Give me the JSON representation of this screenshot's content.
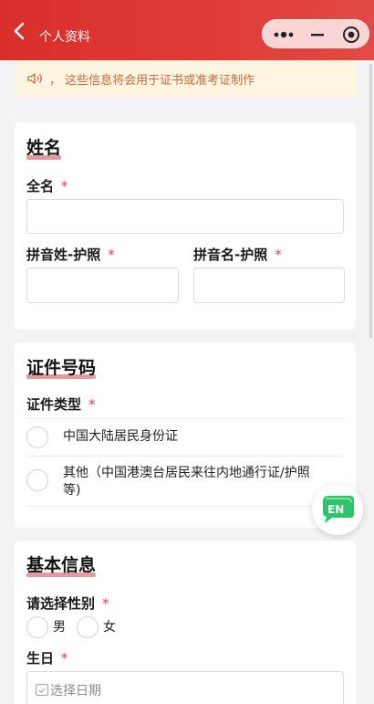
{
  "header": {
    "title": "个人资料"
  },
  "notice": {
    "text": "，  这些信息将会用于证书或准考证制作"
  },
  "name_section": {
    "title": "姓名",
    "full_name_label": "全名",
    "pinyin_surname_label": "拼音姓-护照",
    "pinyin_given_label": "拼音名-护照",
    "required_mark": "*"
  },
  "id_section": {
    "title": "证件号码",
    "id_type_label": "证件类型",
    "options": [
      "中国大陆居民身份证",
      "其他（中国港澳台居民来往内地通行证/护照",
      "等)"
    ]
  },
  "basic_section": {
    "title": "基本信息",
    "gender_label": "请选择性别",
    "gender_options": [
      "男",
      "女"
    ],
    "birthday_label": "生日",
    "birthday_placeholder": "选择日期"
  },
  "language_toggle": {
    "label": "EN"
  },
  "colors": {
    "header_red": "#d92f2c",
    "accent_green": "#2ec46a",
    "required_red": "#e04040",
    "notice_text": "#c86a3c"
  }
}
